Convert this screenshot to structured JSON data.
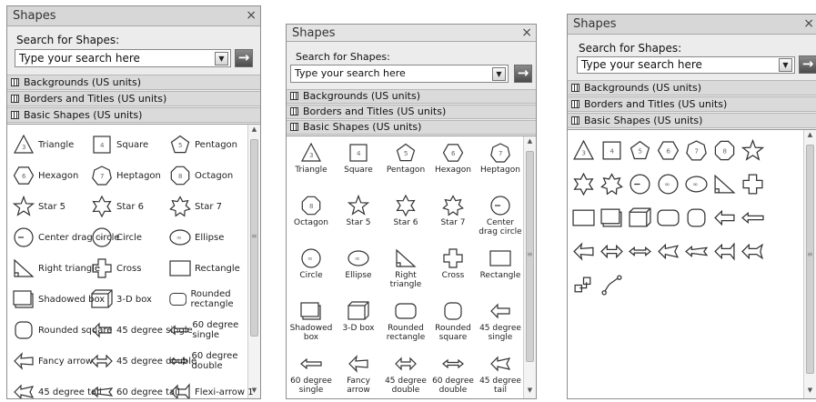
{
  "panels": {
    "list": {
      "title": "Shapes",
      "search_label": "Search for Shapes:",
      "search_value": "Type your search here",
      "stencils": [
        "Backgrounds (US units)",
        "Borders and Titles (US units)",
        "Basic Shapes (US units)"
      ],
      "view": "icons and names"
    },
    "names_under": {
      "title": "Shapes",
      "search_label": "Search for Shapes:",
      "search_value": "Type your search here",
      "stencils": [
        "Backgrounds (US units)",
        "Borders and Titles (US units)",
        "Basic Shapes (US units)"
      ],
      "view": "names under icons"
    },
    "icons_only": {
      "title": "Shapes",
      "search_label": "Search for Shapes:",
      "search_value": "Type your search here",
      "stencils": [
        "Backgrounds (US units)",
        "Borders and Titles (US units)",
        "Basic Shapes (US units)"
      ],
      "view": "icons only"
    }
  },
  "close_glyph": "×",
  "go_glyph": "→",
  "dropdown_glyph": "▼",
  "shape_labels": {
    "list": [
      "Triangle",
      "Square",
      "Pentagon",
      "Hexagon",
      "Heptagon",
      "Octagon",
      "Star 5",
      "Star 6",
      "Star 7",
      "Center drag circle",
      "Circle",
      "Ellipse",
      "Right triangle",
      "Cross",
      "Rectangle",
      "Shadowed box",
      "3-D box",
      "Rounded rectangle",
      "Rounded square",
      "45 degree single",
      "60 degree single",
      "Fancy arrow",
      "45 degree double",
      "60 degree double",
      "45 degree tail",
      "60 degree tail",
      "Flexi-arrow 1"
    ],
    "names_under": [
      "Triangle",
      "Square",
      "Pentagon",
      "Hexagon",
      "Heptagon",
      "Octagon",
      "Star 5",
      "Star 6",
      "Star 7",
      "Center drag circle",
      "Circle",
      "Ellipse",
      "Right triangle",
      "Cross",
      "Rectangle",
      "Shadowed box",
      "3-D box",
      "Rounded rectangle",
      "Rounded square",
      "45 degree single",
      "60 degree single",
      "Fancy arrow",
      "45 degree double",
      "60 degree double",
      "45 degree tail"
    ]
  },
  "icons_only_shapes": [
    "triangle",
    "square",
    "pentagon",
    "hexagon",
    "heptagon",
    "octagon",
    "star-5",
    "star-6",
    "star-7",
    "center-drag-circle",
    "circle",
    "ellipse",
    "right-triangle",
    "cross",
    "rectangle",
    "shadowed-box",
    "3d-box",
    "rounded-rectangle",
    "rounded-square",
    "45-degree-single",
    "60-degree-single",
    "fancy-arrow",
    "45-degree-double",
    "60-degree-double",
    "45-degree-tail",
    "60-degree-tail",
    "flexi-arrow-1",
    "flexi-arrow-2",
    "dynamic-connector",
    "line-curve-connector"
  ],
  "colors": {
    "panel_bg": "#ececec",
    "title_bg": "#d7d7d7",
    "stencil_bg": "#dadada",
    "go_button": "#5a5a5a"
  }
}
